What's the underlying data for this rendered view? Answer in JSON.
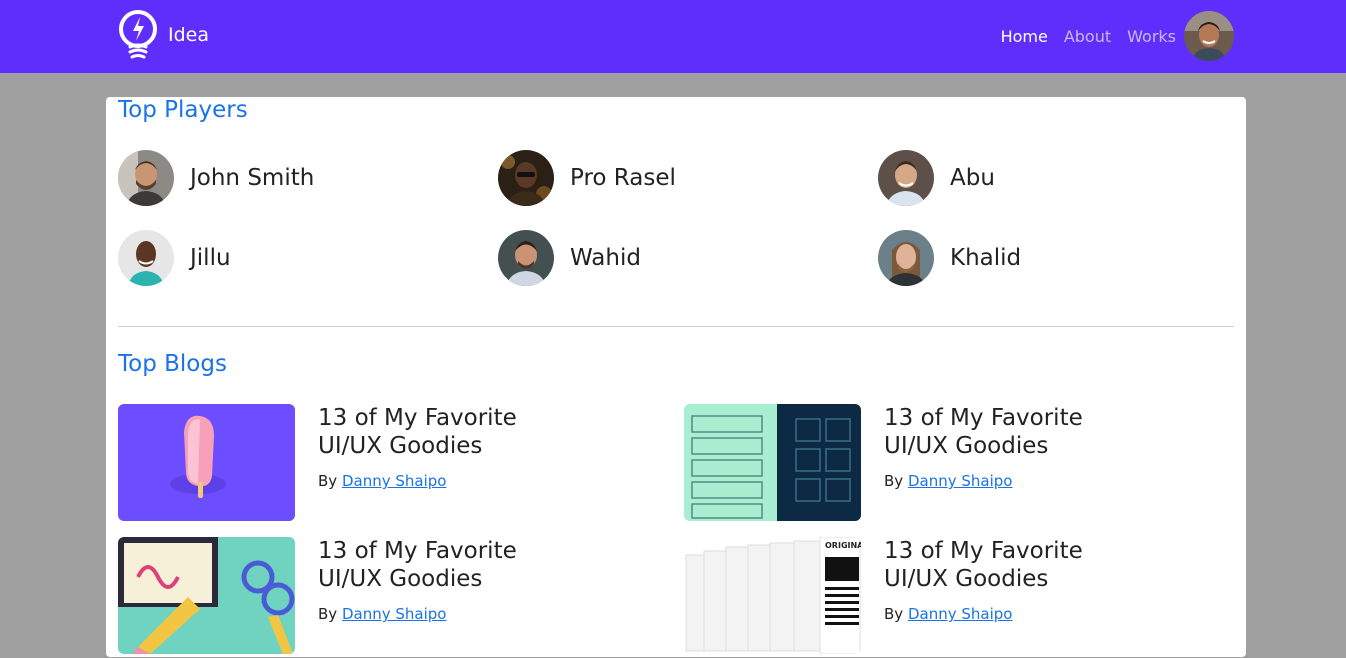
{
  "nav": {
    "brand": "Idea",
    "links": [
      "Home",
      "About",
      "Works"
    ]
  },
  "players": {
    "title": "Top Players",
    "items": [
      {
        "name": "John Smith"
      },
      {
        "name": "Pro Rasel"
      },
      {
        "name": "Abu"
      },
      {
        "name": "Jillu"
      },
      {
        "name": "Wahid"
      },
      {
        "name": "Khalid"
      }
    ]
  },
  "blogs": {
    "title": "Top Blogs",
    "items": [
      {
        "title": "13 of My Favorite UI/UX Goodies",
        "by": "By",
        "author": "Danny Shaipo"
      },
      {
        "title": "13 of My Favorite UI/UX Goodies",
        "by": "By",
        "author": "Danny Shaipo"
      },
      {
        "title": "13 of My Favorite UI/UX Goodies",
        "by": "By",
        "author": "Danny Shaipo"
      },
      {
        "title": "13 of My Favorite UI/UX Goodies",
        "by": "By",
        "author": "Danny Shaipo"
      }
    ],
    "thumb_text": "ORIGINA"
  },
  "colors": {
    "navbar": "#5f2efc",
    "accent": "#1a73e8",
    "page_bg": "#a0a0a0"
  }
}
